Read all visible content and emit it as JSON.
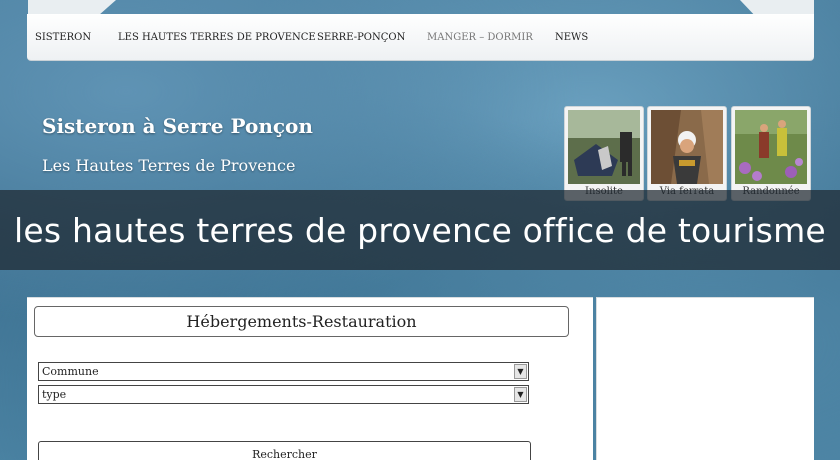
{
  "nav": {
    "items": [
      {
        "label": "SISTERON"
      },
      {
        "label": "LES HAUTES TERRES DE PROVENCE"
      },
      {
        "label": "SERRE-PONÇON"
      },
      {
        "label": "MANGER – DORMIR"
      },
      {
        "label": "NEWS"
      }
    ]
  },
  "header": {
    "title": "Sisteron à Serre Ponçon",
    "subtitle": "Les Hautes Terres de Provence"
  },
  "thumbnails": [
    {
      "label": "Insolite"
    },
    {
      "label": "Via ferrata"
    },
    {
      "label": "Randonnée"
    }
  ],
  "banner": {
    "text": "les hautes terres de provence office de tourisme"
  },
  "search_box": {
    "title": "Hébergements-Restauration",
    "commune_select": "Commune",
    "type_select": "type",
    "button_label": "Rechercher"
  },
  "colors": {
    "banner_bg": "#1e2830",
    "nav_bg": "#ffffff",
    "page_bg": "#4a7f9f"
  }
}
